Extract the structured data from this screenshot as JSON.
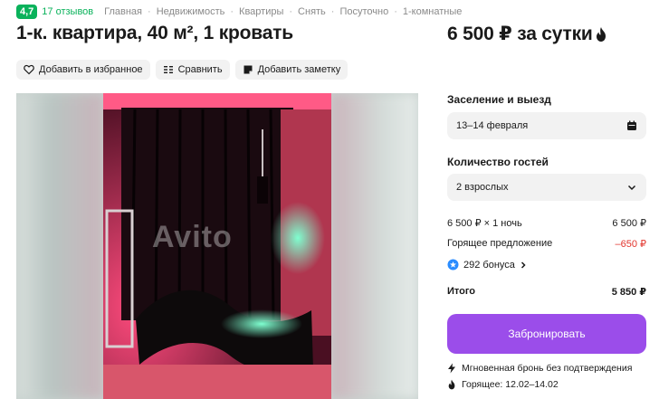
{
  "header": {
    "rating": "4,7",
    "reviews": "17 отзывов",
    "breadcrumbs": [
      "Главная",
      "Недвижимость",
      "Квартиры",
      "Снять",
      "Посуточно",
      "1-комнатные"
    ],
    "breadcrumb_separator": "·"
  },
  "listing": {
    "title": "1-к. квартира, 40 м², 1 кровать",
    "price": "6 500 ₽ за сутки"
  },
  "actions": {
    "favorite": "Добавить в избранное",
    "compare": "Сравнить",
    "note": "Добавить заметку"
  },
  "photo": {
    "watermark": "Avito"
  },
  "booking": {
    "checkin_label": "Заселение и выезд",
    "checkin_value": "13–14 февраля",
    "guests_label": "Количество гостей",
    "guests_value": "2 взрослых",
    "line_item_label": "6 500 ₽ × 1 ночь",
    "line_item_value": "6 500 ₽",
    "hot_deal_label": "Горящее предложение",
    "hot_deal_value": "–650 ₽",
    "bonus_text": "292 бонуса",
    "total_label": "Итого",
    "total_value": "5 850 ₽",
    "book_button": "Забронировать",
    "note_instant": "Мгновенная бронь без подтверждения",
    "note_hot": "Горящее: 12.02–14.02"
  },
  "colors": {
    "accent_green": "#0ab25b",
    "primary_purple": "#9b4dea",
    "discount_red": "#e2352d"
  },
  "icons": [
    "heart-icon",
    "compare-icon",
    "note-icon",
    "fire-icon",
    "calendar-icon",
    "chevron-down-icon",
    "bonus-icon",
    "chevron-right-icon",
    "lightning-icon"
  ]
}
